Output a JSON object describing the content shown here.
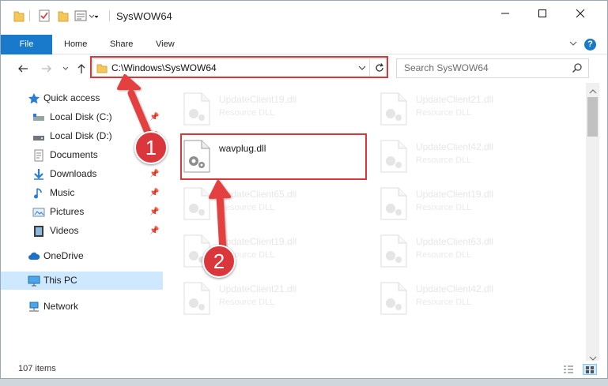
{
  "window": {
    "title": "SysWOW64"
  },
  "ribbon": {
    "tabs": [
      "File",
      "Home",
      "Share",
      "View"
    ]
  },
  "address": {
    "path": "C:\\Windows\\SysWOW64"
  },
  "search": {
    "placeholder": "Search SysWOW64"
  },
  "sidebar": {
    "items": [
      {
        "label": "Quick access",
        "icon": "star-icon"
      },
      {
        "label": "Local Disk (C:)",
        "icon": "drive-icon",
        "pinned": true
      },
      {
        "label": "Local Disk (D:)",
        "icon": "drive-icon",
        "pinned": true
      },
      {
        "label": "Documents",
        "icon": "documents-icon",
        "pinned": true
      },
      {
        "label": "Downloads",
        "icon": "download-icon",
        "pinned": true
      },
      {
        "label": "Music",
        "icon": "music-icon",
        "pinned": true
      },
      {
        "label": "Pictures",
        "icon": "pictures-icon",
        "pinned": true
      },
      {
        "label": "Videos",
        "icon": "video-icon",
        "pinned": true
      },
      {
        "label": "OneDrive",
        "icon": "cloud-icon"
      },
      {
        "label": "This PC",
        "icon": "computer-icon",
        "selected": true
      },
      {
        "label": "Network",
        "icon": "network-icon"
      }
    ]
  },
  "files": {
    "left": [
      {
        "name": "UpdateClient19.dll",
        "type": "Resource DLL"
      },
      {
        "name": "wavplug.dll",
        "type": ""
      },
      {
        "name": "UpdateClient65.dll",
        "type": "Resource DLL"
      },
      {
        "name": "UpdateClient19.dll",
        "type": "Resource DLL"
      },
      {
        "name": "UpdateClient21.dll",
        "type": "Resource DLL"
      }
    ],
    "right": [
      {
        "name": "UpdateClient21.dll",
        "type": "Resource DLL"
      },
      {
        "name": "UpdateClient42.dll",
        "type": "Resource DLL"
      },
      {
        "name": "UpdateClient19.dll",
        "type": "Resource DLL"
      },
      {
        "name": "UpdateClient63.dll",
        "type": "Resource DLL"
      },
      {
        "name": "UpdateClient42.dll",
        "type": "Resource DLL"
      }
    ]
  },
  "status": {
    "item_count": "107 items"
  },
  "annotations": {
    "step1": "1",
    "step2": "2",
    "color": "#d9373b"
  },
  "colors": {
    "accent": "#1979ca",
    "selection": "#cde8ff"
  }
}
